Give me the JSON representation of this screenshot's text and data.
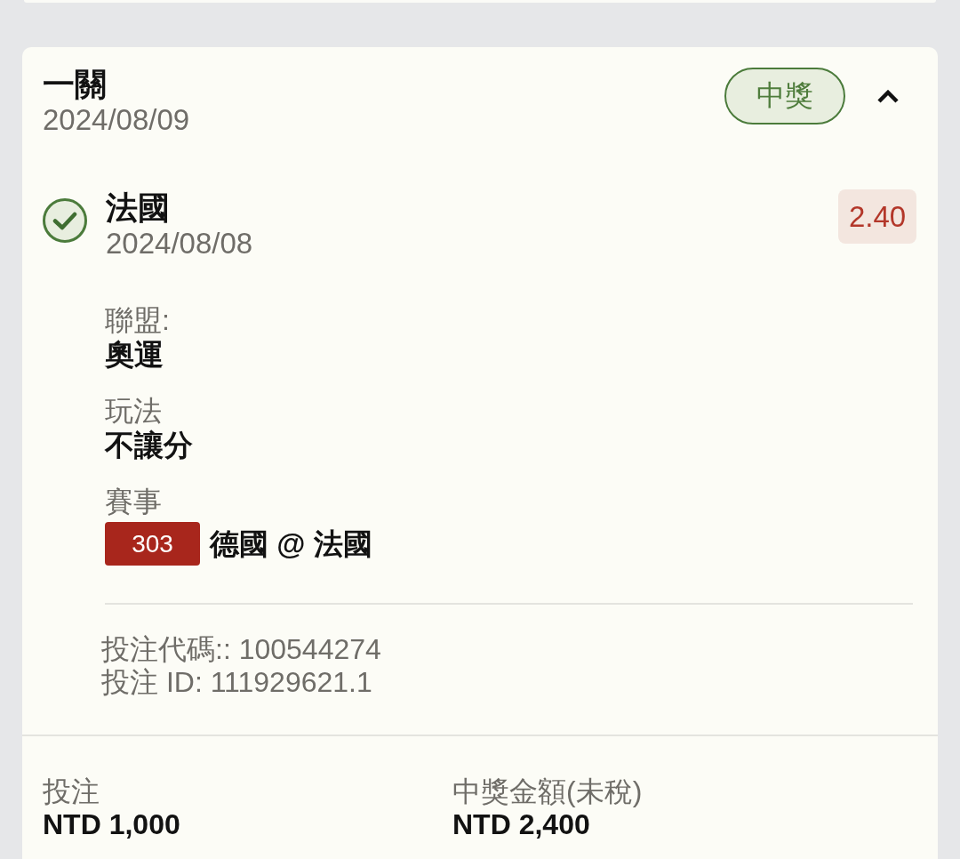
{
  "bet": {
    "title": "一關",
    "date": "2024/08/09",
    "status": {
      "kind": "won",
      "label": "中獎"
    },
    "expanded": true,
    "selections": [
      {
        "name": "法國",
        "date": "2024/08/08",
        "won": true,
        "odds": "2.40",
        "details": [
          {
            "kind": "text",
            "label": "聯盟:",
            "value": "奧運"
          },
          {
            "kind": "text",
            "label": "玩法",
            "value": "不讓分"
          },
          {
            "kind": "event",
            "label": "賽事",
            "number": "303",
            "value": "德國 @ 法國"
          }
        ],
        "codes": [
          "投注代碼:: 100544274",
          "投注 ID: 111929621.1"
        ]
      }
    ]
  },
  "summary": [
    {
      "label": "投注",
      "value": "NTD 1,000"
    },
    {
      "label": "中獎金額(未稅)",
      "value": "NTD 2,400"
    }
  ]
}
